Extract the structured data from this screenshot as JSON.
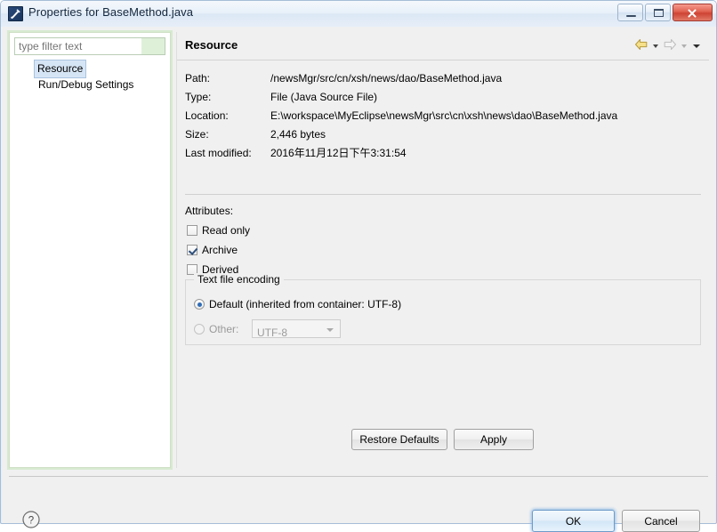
{
  "window": {
    "title": "Properties for BaseMethod.java",
    "icon": "myeclipse-icon",
    "controls": {
      "minimize": "Minimize",
      "maximize": "Maximize",
      "close": "Close"
    }
  },
  "sidebar": {
    "filter": {
      "placeholder": "type filter text",
      "value": ""
    },
    "items": [
      {
        "label": "Resource",
        "selected": true
      },
      {
        "label": "Run/Debug Settings",
        "selected": false
      }
    ]
  },
  "content": {
    "title": "Resource",
    "toolbar": {
      "back": "back-arrow-icon",
      "back_menu": "chevron-down-icon",
      "forward": "forward-arrow-icon",
      "forward_menu": "chevron-down-icon",
      "menu": "chevron-down-icon"
    },
    "properties": [
      {
        "label": "Path:",
        "value": "/newsMgr/src/cn/xsh/news/dao/BaseMethod.java"
      },
      {
        "label": "Type:",
        "value": "File  (Java Source File)"
      },
      {
        "label": "Location:",
        "value": "E:\\workspace\\MyEclipse\\newsMgr\\src\\cn\\xsh\\news\\dao\\BaseMethod.java"
      },
      {
        "label": "Size:",
        "value": "2,446  bytes"
      },
      {
        "label": "Last modified:",
        "value": "2016年11月12日下午3:31:54"
      }
    ],
    "attributes": {
      "title": "Attributes:",
      "items": [
        {
          "label": "Read only",
          "checked": false
        },
        {
          "label": "Archive",
          "checked": true
        },
        {
          "label": "Derived",
          "checked": false
        }
      ]
    },
    "encoding": {
      "group_title": "Text file encoding",
      "default_label": "Default (inherited from container: UTF-8)",
      "default_selected": true,
      "other_label": "Other:",
      "other_selected": false,
      "other_value": "UTF-8",
      "other_enabled": false
    },
    "restore_defaults_label": "Restore Defaults",
    "apply_label": "Apply"
  },
  "footer": {
    "help": "help-icon",
    "ok_label": "OK",
    "cancel_label": "Cancel"
  },
  "colors": {
    "accent": "#2f6cb5",
    "panel_bg": "#f0f0f0",
    "tree_border": "#cfe0c8",
    "selection": "#d6e5f5",
    "close_button": "#ce4333"
  }
}
